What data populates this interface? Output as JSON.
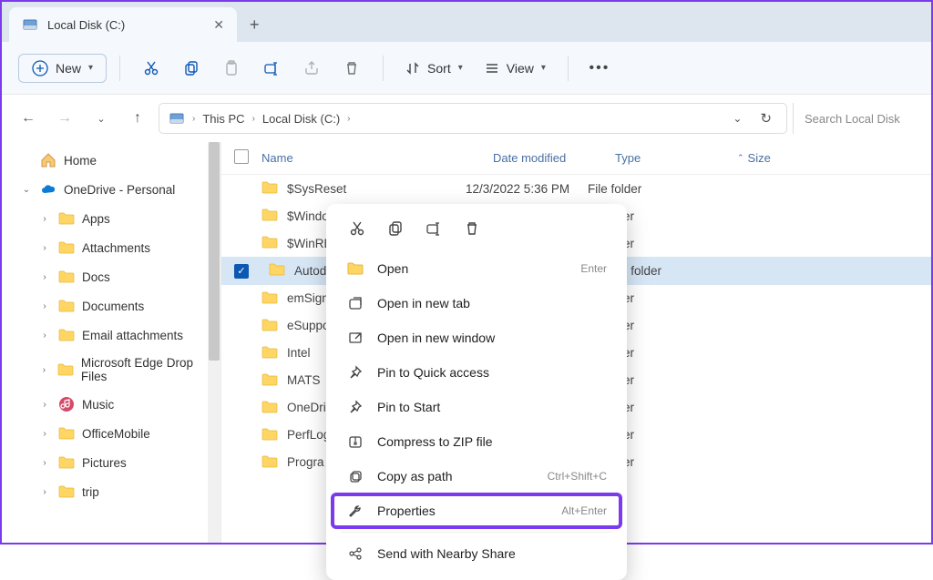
{
  "tab": {
    "title": "Local Disk (C:)"
  },
  "toolbar": {
    "new_label": "New",
    "sort_label": "Sort",
    "view_label": "View"
  },
  "breadcrumb": {
    "part1": "This PC",
    "part2": "Local Disk (C:)"
  },
  "search": {
    "placeholder": "Search Local Disk"
  },
  "sidebar": {
    "home": "Home",
    "onedrive": "OneDrive - Personal",
    "items": [
      "Apps",
      "Attachments",
      "Docs",
      "Documents",
      "Email attachments",
      "Microsoft Edge Drop Files",
      "Music",
      "OfficeMobile",
      "Pictures",
      "trip"
    ]
  },
  "columns": {
    "name": "Name",
    "date": "Date modified",
    "type": "Type",
    "size": "Size"
  },
  "rows": [
    {
      "name": "$SysReset",
      "date": "12/3/2022 5:36 PM",
      "type": "File folder",
      "selected": false
    },
    {
      "name": "$Windo",
      "date": "",
      "type": "ile folder",
      "selected": false
    },
    {
      "name": "$WinRE",
      "date": "",
      "type": "ile folder",
      "selected": false
    },
    {
      "name": "Autode",
      "date": "",
      "type": "ile folder",
      "selected": true
    },
    {
      "name": "emSign",
      "date": "",
      "type": "ile folder",
      "selected": false
    },
    {
      "name": "eSuppo",
      "date": "",
      "type": "ile folder",
      "selected": false
    },
    {
      "name": "Intel",
      "date": "",
      "type": "ile folder",
      "selected": false
    },
    {
      "name": "MATS",
      "date": "",
      "type": "ile folder",
      "selected": false
    },
    {
      "name": "OneDri",
      "date": "",
      "type": "ile folder",
      "selected": false
    },
    {
      "name": "PerfLog",
      "date": "",
      "type": "ile folder",
      "selected": false
    },
    {
      "name": "Progra",
      "date": "",
      "type": "ile folder",
      "selected": false
    }
  ],
  "context_menu": {
    "items": [
      {
        "label": "Open",
        "shortcut": "Enter",
        "icon": "open"
      },
      {
        "label": "Open in new tab",
        "shortcut": "",
        "icon": "new-tab"
      },
      {
        "label": "Open in new window",
        "shortcut": "",
        "icon": "new-window"
      },
      {
        "label": "Pin to Quick access",
        "shortcut": "",
        "icon": "pin"
      },
      {
        "label": "Pin to Start",
        "shortcut": "",
        "icon": "pin"
      },
      {
        "label": "Compress to ZIP file",
        "shortcut": "",
        "icon": "zip"
      },
      {
        "label": "Copy as path",
        "shortcut": "Ctrl+Shift+C",
        "icon": "path"
      },
      {
        "label": "Properties",
        "shortcut": "Alt+Enter",
        "icon": "wrench",
        "highlight": true
      },
      {
        "label": "Send with Nearby Share",
        "shortcut": "",
        "icon": "share"
      }
    ]
  }
}
